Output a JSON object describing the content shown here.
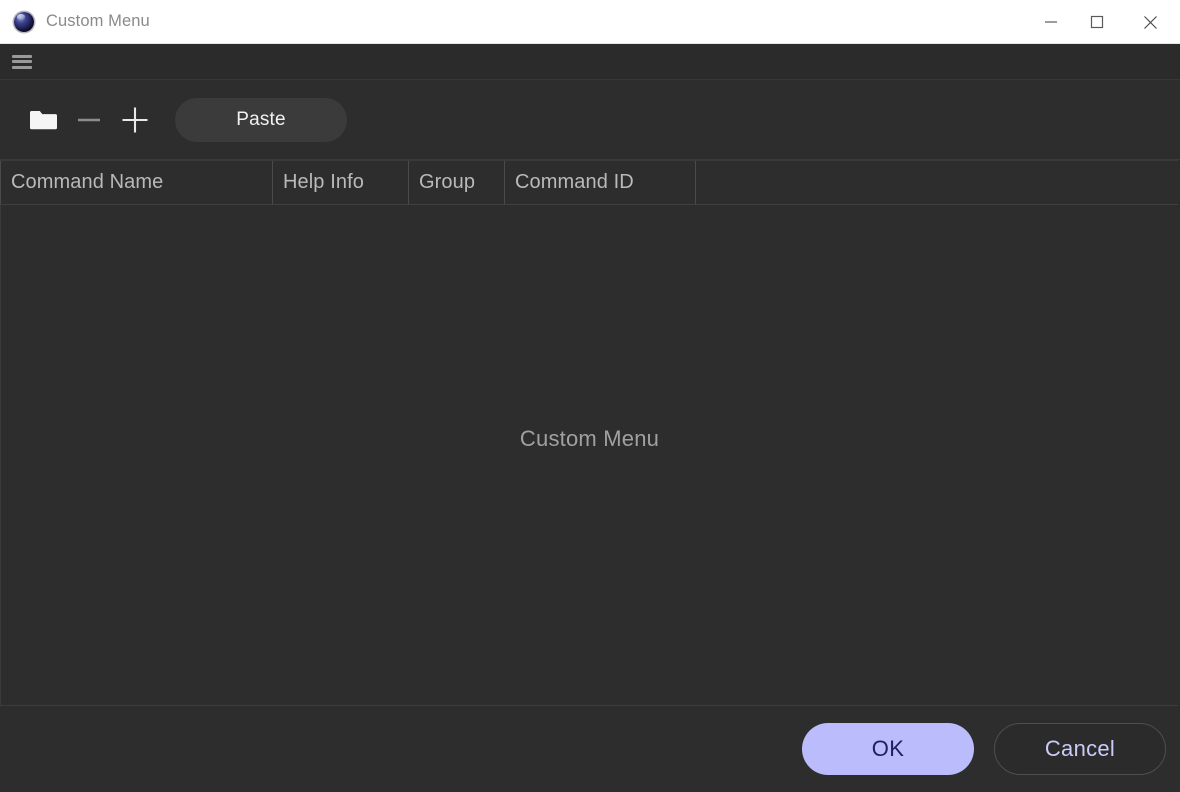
{
  "window": {
    "title": "Custom Menu",
    "app_icon": "sphere-logo-icon",
    "controls": {
      "minimize": "minimize-icon",
      "maximize": "maximize-icon",
      "close": "close-icon"
    }
  },
  "menu_strip": {
    "hamburger": "hamburger-menu-icon"
  },
  "toolbar": {
    "folder_icon": "folder-icon",
    "remove_icon": "minus-icon",
    "add_icon": "plus-icon",
    "paste_label": "Paste"
  },
  "table": {
    "columns": [
      {
        "label": "Command Name"
      },
      {
        "label": "Help Info"
      },
      {
        "label": "Group"
      },
      {
        "label": "Command ID"
      },
      {
        "label": ""
      }
    ],
    "rows": [],
    "empty_message": "Custom Menu"
  },
  "footer": {
    "ok_label": "OK",
    "cancel_label": "Cancel"
  },
  "colors": {
    "titlebar_bg": "#ffffff",
    "window_bg": "#2e2d2d",
    "menu_strip_bg": "#2b2b2b",
    "pill_bg": "#3b3b3b",
    "accent": "#bbbcfb",
    "accent_text": "#20205e",
    "cancel_text": "#c9cbfa",
    "header_text": "#b9b9b9",
    "empty_text": "#a0a0a0",
    "title_text": "#8a8a8a"
  }
}
